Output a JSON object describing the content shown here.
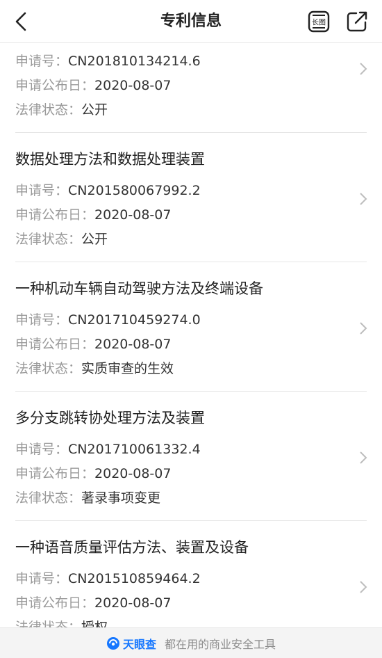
{
  "nav": {
    "title": "专利信息",
    "long_image_label": "长图"
  },
  "labels": {
    "app_no": "申请号：",
    "pub_date": "申请公布日：",
    "status": "法律状态："
  },
  "patents": [
    {
      "title": "",
      "app_no": "CN201810134214.6",
      "pub_date": "2020-08-07",
      "status": "公开"
    },
    {
      "title": "数据处理方法和数据处理装置",
      "app_no": "CN201580067992.2",
      "pub_date": "2020-08-07",
      "status": "公开"
    },
    {
      "title": "一种机动车辆自动驾驶方法及终端设备",
      "app_no": "CN201710459274.0",
      "pub_date": "2020-08-07",
      "status": "实质审查的生效"
    },
    {
      "title": "多分支跳转协处理方法及装置",
      "app_no": "CN201710061332.4",
      "pub_date": "2020-08-07",
      "status": "著录事项变更"
    },
    {
      "title": "一种语音质量评估方法、装置及设备",
      "app_no": "CN201510859464.2",
      "pub_date": "2020-08-07",
      "status": "授权"
    }
  ],
  "footer": {
    "brand": "天眼查",
    "slogan": "都在用的商业安全工具",
    "brand_color": "#1677ff"
  }
}
